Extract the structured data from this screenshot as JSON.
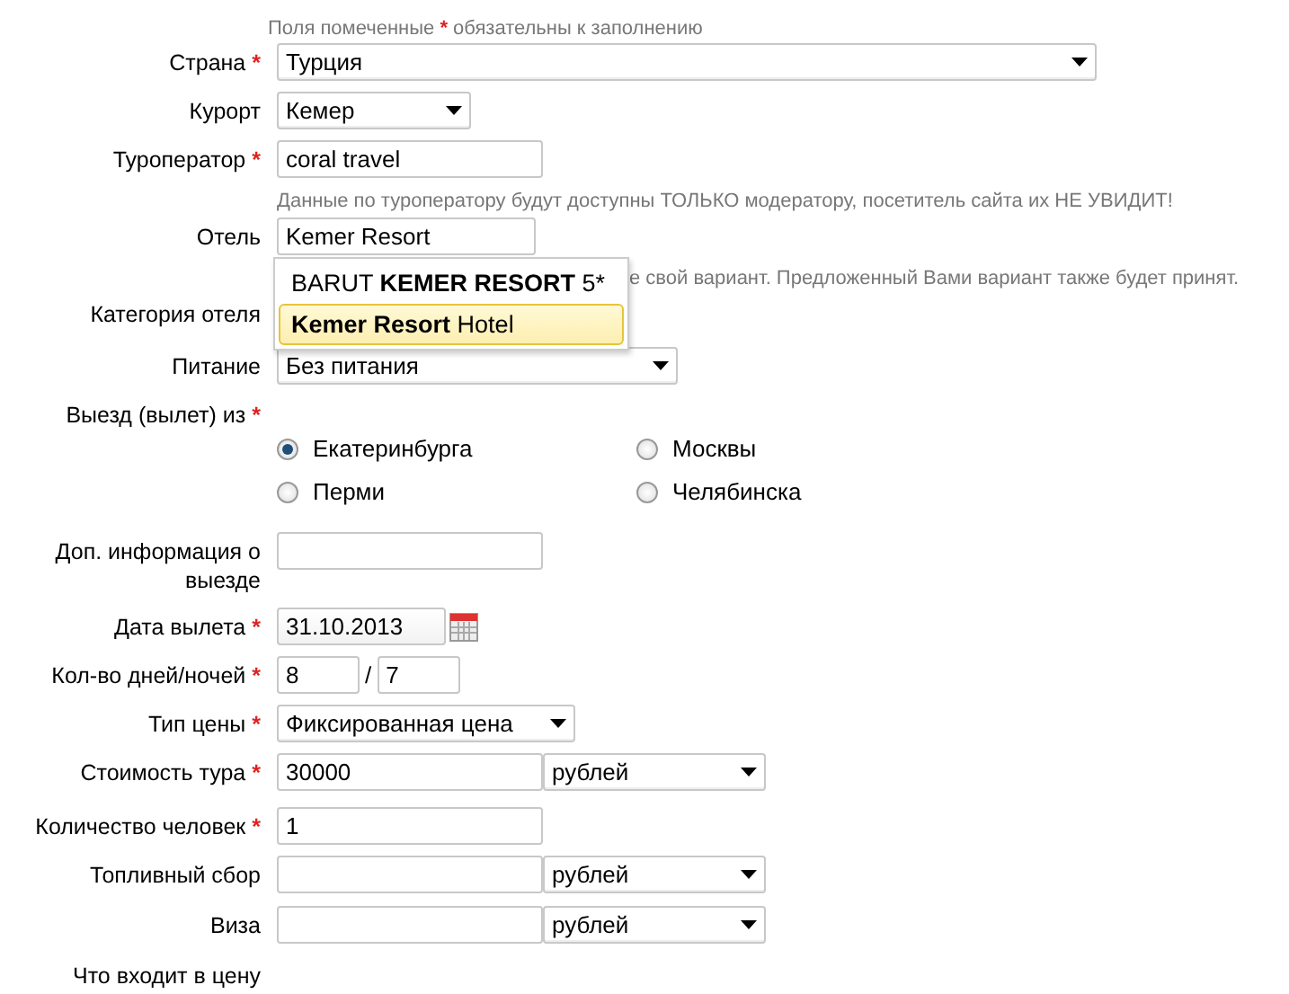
{
  "required_note": {
    "text": "Поля помеченные",
    "mark": "*",
    "rest": "обязательны к заполнению"
  },
  "fields": [
    {
      "kind": "select",
      "label": "Страна",
      "mark": "*",
      "value": "Турция"
    },
    {
      "kind": "select",
      "label": "Курорт",
      "value": "Кемер"
    },
    {
      "kind": "text",
      "label": "Туроператор",
      "mark": "*",
      "value": "coral travel"
    },
    {
      "kind": "hint",
      "text": "Данные по туроператору будут доступны ТОЛЬКО модератору, посетитель сайта их НЕ УВИДИТ!"
    },
    {
      "kind": "text",
      "label": "Отель",
      "value": "Kemer Resort"
    },
    {
      "kind": "hint",
      "text": "е свой вариант. Предложенный Вами вариант также будет принят."
    },
    {
      "kind": "label",
      "label": "Категория отеля"
    },
    {
      "kind": "select",
      "label": "Питание",
      "value": "Без питания"
    },
    {
      "kind": "radio",
      "label": "Выезд (вылет) из",
      "mark": "*",
      "options": [
        {
          "label": "Екатеринбурга",
          "selected": true
        },
        {
          "label": "Москвы",
          "selected": false
        },
        {
          "label": "Перми",
          "selected": false
        },
        {
          "label": "Челябинска",
          "selected": false
        }
      ]
    },
    {
      "kind": "text",
      "label": "Доп. информация о выезде"
    },
    {
      "kind": "date",
      "label": "Дата вылета",
      "mark": "*",
      "value": "31.10.2013"
    },
    {
      "kind": "pair",
      "label": "Кол-во дней/ночей",
      "mark": "*",
      "value": "8",
      "separator": "/",
      "value2": "7"
    },
    {
      "kind": "select",
      "label": "Тип цены",
      "mark": "*",
      "value": "Фиксированная цена"
    },
    {
      "kind": "price",
      "label": "Стоимость тура",
      "mark": "*",
      "value": "30000",
      "currency": "рублей"
    },
    {
      "kind": "text",
      "label": "Количество человек",
      "mark": "*",
      "value": "1"
    },
    {
      "kind": "price",
      "label": "Топливный сбор",
      "currency": "рублей"
    },
    {
      "kind": "price",
      "label": "Виза",
      "currency": "рублей"
    },
    {
      "kind": "label",
      "label": "Что входит в цену"
    }
  ],
  "hotel_suggestions": [
    {
      "text": "BARUT **KEMER RESORT** 5*",
      "selected": false
    },
    {
      "text": "**Kemer Resort** Hotel",
      "selected": true
    }
  ]
}
